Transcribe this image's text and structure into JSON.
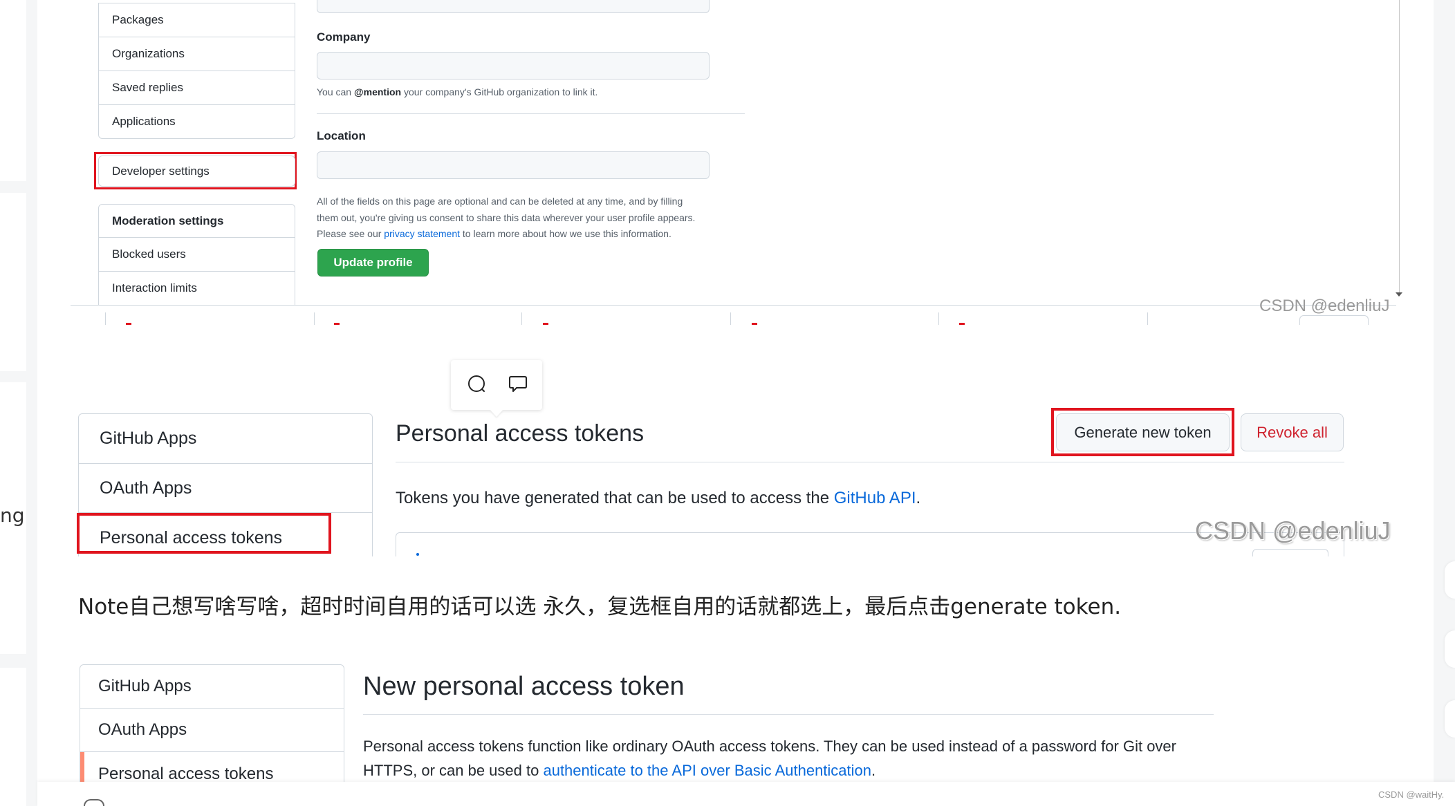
{
  "left_strip": {
    "fragment_text": "ng"
  },
  "colors": {
    "highlight_red": "#e0141e",
    "github_green": "#2da44e",
    "link_blue": "#0969da",
    "danger_red": "#cf222e",
    "active_nav_orange": "#fd8c73",
    "text_dark": "#24292f",
    "muted_text": "#57606a",
    "watermark_gray": "#9a9a9a"
  },
  "profile_settings": {
    "nav_items": [
      "Packages",
      "Organizations",
      "Saved replies",
      "Applications"
    ],
    "developer_settings": "Developer settings",
    "moderation": {
      "title": "Moderation settings",
      "items": [
        "Blocked users",
        "Interaction limits"
      ]
    },
    "company": {
      "label": "Company",
      "value": "",
      "help_prefix": "You can ",
      "help_mention": "@mention",
      "help_suffix": " your company's GitHub organization to link it."
    },
    "location": {
      "label": "Location",
      "value": ""
    },
    "disclaimer": {
      "line1": "All of the fields on this page are optional and can be deleted at any time, and by filling",
      "line2": "them out, you're giving us consent to share this data wherever your user profile appears.",
      "line3_prefix": "Please see our ",
      "line3_link": "privacy statement",
      "line3_suffix": " to learn more about how we use this information."
    },
    "update_button": "Update profile",
    "watermark": "CSDN @edenliuJ"
  },
  "selection_toolbar": {
    "icons": [
      "search-icon",
      "comment-icon"
    ]
  },
  "tokens_page": {
    "nav_items": [
      "GitHub Apps",
      "OAuth Apps",
      "Personal access tokens"
    ],
    "title": "Personal access tokens",
    "generate_button": "Generate new token",
    "revoke_button": "Revoke all",
    "description_prefix": "Tokens you have generated that can be used to access the ",
    "description_link": "GitHub API",
    "description_suffix": ".",
    "watermark": "CSDN @edenliuJ"
  },
  "note_text": "Note自己想写啥写啥，超时时间自用的话可以选 永久，复选框自用的话就都选上，最后点击generate token.",
  "new_token_page": {
    "nav_items": [
      "GitHub Apps",
      "OAuth Apps",
      "Personal access tokens"
    ],
    "title": "New personal access token",
    "description_line1": "Personal access tokens function like ordinary OAuth access tokens. They can be used instead of a password for Git over",
    "description_line2_prefix": "HTTPS, or can be used to ",
    "description_link": "authenticate to the API over Basic Authentication",
    "description_line2_suffix": "."
  },
  "footer": {
    "watermark": "CSDN @waitHy."
  }
}
